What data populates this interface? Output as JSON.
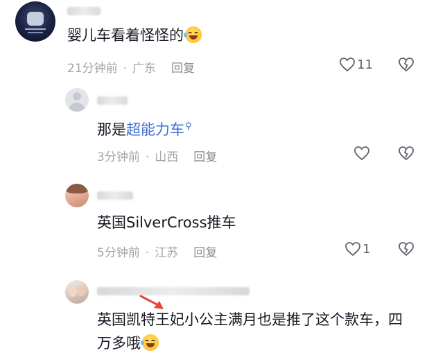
{
  "comments": [
    {
      "text": "婴儿车看着怪怪的",
      "emoji": "laugh-cry-emoji",
      "time": "21分钟前",
      "dot": "·",
      "location": "广东",
      "reply_label": "回复",
      "like_count": "11"
    },
    {
      "text_prefix": "那是",
      "link_text": "超能力车",
      "time": "3分钟前",
      "dot": "·",
      "location": "山西",
      "reply_label": "回复",
      "like_count": ""
    },
    {
      "text": "英国SilverCross推车",
      "time": "5分钟前",
      "dot": "·",
      "location": "江苏",
      "reply_label": "回复",
      "like_count": "1"
    },
    {
      "text": "英国凯特王妃小公主满月也是推了这个款车，四万多哦",
      "emoji": "laugh-cry-emoji"
    }
  ],
  "icons": {
    "like": "heart-outline-icon",
    "dislike": "broken-heart-icon",
    "search": "search-icon"
  },
  "colors": {
    "text": "#161823",
    "meta": "#a3a4a9",
    "link": "#3b6bd6",
    "arrow": "#e8443a"
  }
}
